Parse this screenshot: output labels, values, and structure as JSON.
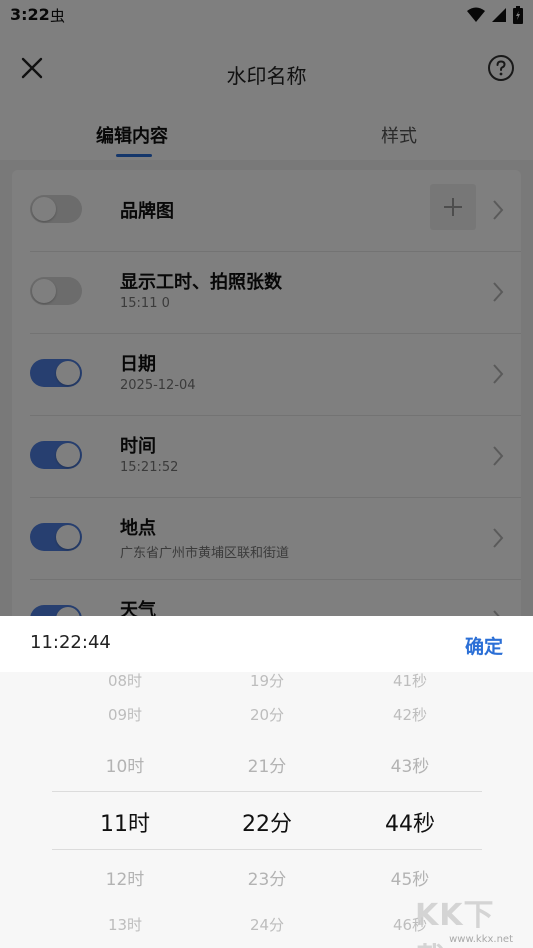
{
  "status_bar": {
    "time": "3:22",
    "extra": "虫"
  },
  "header": {
    "title": "水印名称"
  },
  "tabs": [
    {
      "label": "编辑内容",
      "active": true
    },
    {
      "label": "样式",
      "active": false
    }
  ],
  "rows": [
    {
      "title": "品牌图",
      "subtitle": "",
      "toggle_on": false,
      "has_add": true
    },
    {
      "title": "显示工时、拍照张数",
      "subtitle": "15:11  0",
      "toggle_on": false,
      "has_add": false
    },
    {
      "title": "日期",
      "subtitle": "2025-12-04",
      "toggle_on": true,
      "has_add": false
    },
    {
      "title": "时间",
      "subtitle": "15:21:52",
      "toggle_on": true,
      "has_add": false
    },
    {
      "title": "地点",
      "subtitle": "广东省广州市黄埔区联和街道",
      "toggle_on": true,
      "has_add": false
    },
    {
      "title": "天气",
      "subtitle": "",
      "toggle_on": true,
      "has_add": false
    }
  ],
  "time_picker": {
    "current_value": "11:22:44",
    "confirm_label": "确定",
    "hours": [
      "08时",
      "09时",
      "10时",
      "11时",
      "12时",
      "13时"
    ],
    "minutes": [
      "19分",
      "20分",
      "21分",
      "22分",
      "23分",
      "24分"
    ],
    "seconds": [
      "41秒",
      "42秒",
      "43秒",
      "44秒",
      "45秒",
      "46秒"
    ],
    "selected_index": 3
  },
  "watermark": {
    "brand": "KK下载",
    "url": "www.kkx.net"
  },
  "colors": {
    "accent": "#2b6fd6",
    "toggle_on": "#4f7fe0",
    "toggle_off": "#d8d8d8"
  }
}
